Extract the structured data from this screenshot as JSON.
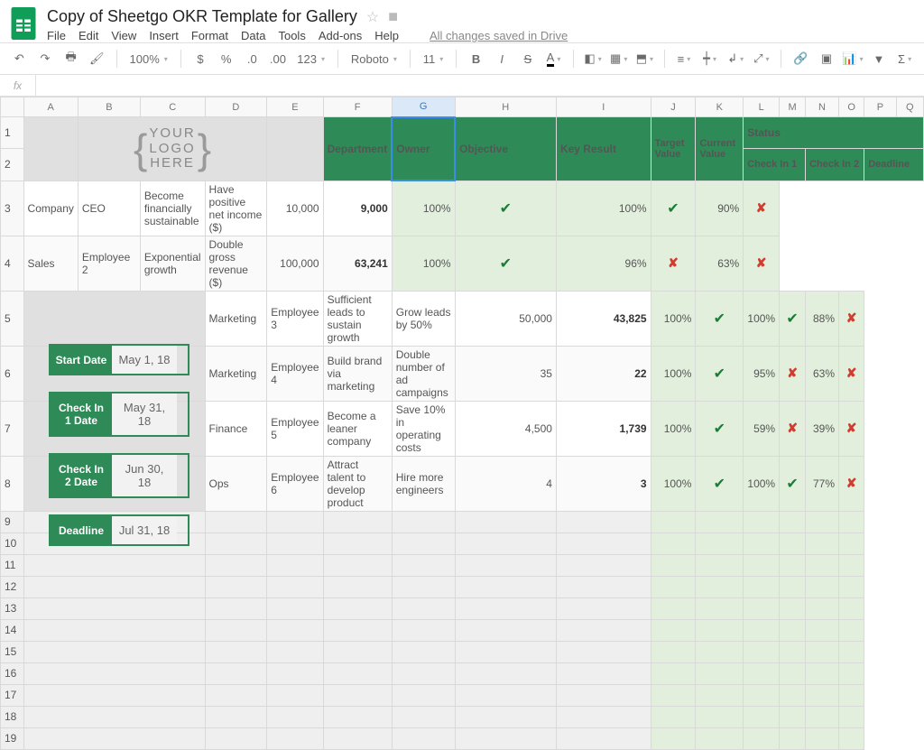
{
  "app": {
    "doc_title": "Copy of Sheetgo OKR Template for Gallery",
    "saved_text": "All changes saved in Drive",
    "menus": [
      "File",
      "Edit",
      "View",
      "Insert",
      "Format",
      "Data",
      "Tools",
      "Add-ons",
      "Help"
    ],
    "zoom": "100%",
    "font_name": "Roboto",
    "font_size": "11",
    "fx_label": "fx"
  },
  "columns": [
    "A",
    "B",
    "C",
    "D",
    "E",
    "F",
    "G",
    "H",
    "I",
    "J",
    "K",
    "L",
    "M",
    "N",
    "O",
    "P",
    "Q"
  ],
  "row_numbers": [
    1,
    2,
    3,
    4,
    5,
    6,
    7,
    8,
    9,
    10,
    11,
    12,
    13,
    14,
    15,
    16,
    17,
    18,
    19
  ],
  "selected_cell": "G1",
  "logo_placeholder_lines": [
    "YOUR",
    "LOGO",
    "HERE"
  ],
  "dates": [
    {
      "label": "Start Date",
      "value": "May 1, 18"
    },
    {
      "label": "Check In 1 Date",
      "value": "May 31, 18"
    },
    {
      "label": "Check In 2 Date",
      "value": "Jun 30, 18"
    },
    {
      "label": "Deadline",
      "value": "Jul 31, 18"
    }
  ],
  "headers": {
    "department": "Department",
    "owner": "Owner",
    "objective": "Objective",
    "key_result": "Key Result",
    "target_value": "Target Value",
    "current_value": "Current Value",
    "status": "Status",
    "check_in_1": "Check In 1",
    "check_in_2": "Check In 2",
    "deadline": "Deadline"
  },
  "rows": [
    {
      "dept": "Company",
      "owner": "CEO",
      "objective": "Become financially sustainable",
      "key_result": "Have positive net income ($)",
      "target": "10,000",
      "current": "9,000",
      "c1": "100%",
      "c1s": "✔",
      "c2": "100%",
      "c2s": "✔",
      "dl": "90%",
      "dls": "✘"
    },
    {
      "dept": "Sales",
      "owner": "Employee 2",
      "objective": "Exponential growth",
      "key_result": "Double gross revenue ($)",
      "target": "100,000",
      "current": "63,241",
      "c1": "100%",
      "c1s": "✔",
      "c2": "96%",
      "c2s": "✘",
      "dl": "63%",
      "dls": "✘"
    },
    {
      "dept": "Marketing",
      "owner": "Employee 3",
      "objective": "Sufficient leads to sustain growth",
      "key_result": "Grow leads by 50%",
      "target": "50,000",
      "current": "43,825",
      "c1": "100%",
      "c1s": "✔",
      "c2": "100%",
      "c2s": "✔",
      "dl": "88%",
      "dls": "✘"
    },
    {
      "dept": "Marketing",
      "owner": "Employee 4",
      "objective": "Build brand via marketing",
      "key_result": "Double number of ad campaigns",
      "target": "35",
      "current": "22",
      "c1": "100%",
      "c1s": "✔",
      "c2": "95%",
      "c2s": "✘",
      "dl": "63%",
      "dls": "✘"
    },
    {
      "dept": "Finance",
      "owner": "Employee 5",
      "objective": "Become a leaner company",
      "key_result": "Save 10% in operating costs",
      "target": "4,500",
      "current": "1,739",
      "c1": "100%",
      "c1s": "✔",
      "c2": "59%",
      "c2s": "✘",
      "dl": "39%",
      "dls": "✘"
    },
    {
      "dept": "Ops",
      "owner": "Employee 6",
      "objective": "Attract talent to develop product",
      "key_result": "Hire more engineers",
      "target": "4",
      "current": "3",
      "c1": "100%",
      "c1s": "✔",
      "c2": "100%",
      "c2s": "✔",
      "dl": "77%",
      "dls": "✘"
    }
  ],
  "currency_symbol": "$",
  "percent_symbol": "%"
}
